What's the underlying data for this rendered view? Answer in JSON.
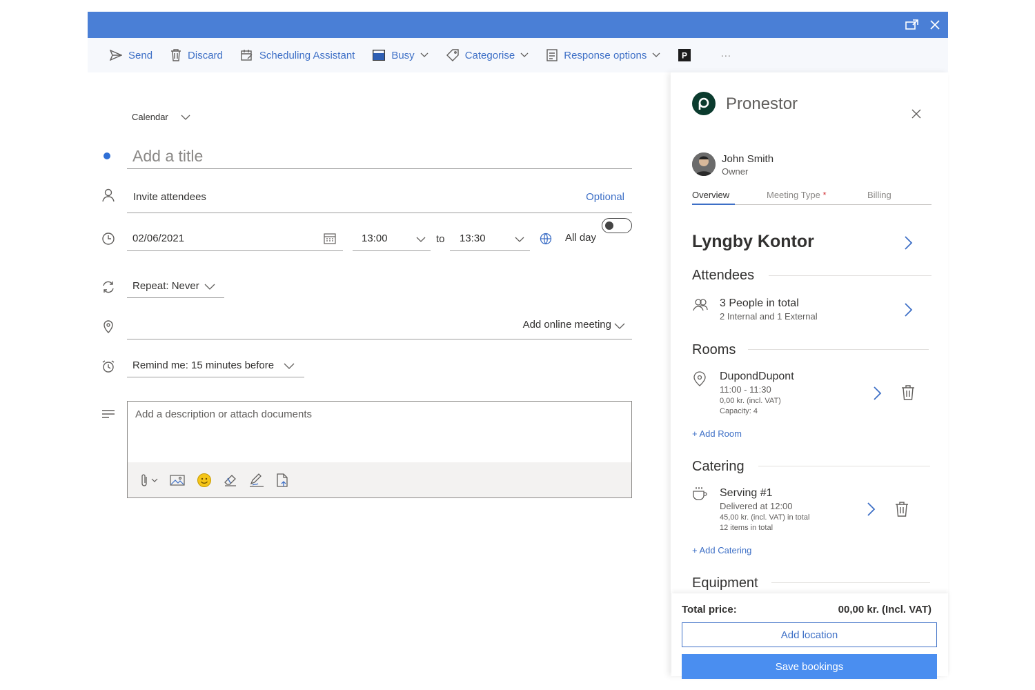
{
  "toolbar": {
    "send": "Send",
    "discard": "Discard",
    "scheduling": "Scheduling Assistant",
    "busy": "Busy",
    "categorise": "Categorise",
    "response": "Response options",
    "more": "···"
  },
  "form": {
    "calendar": "Calendar",
    "title_placeholder": "Add a title",
    "attendees_placeholder": "Invite attendees",
    "optional": "Optional",
    "date": "02/06/2021",
    "start_time": "13:00",
    "to": "to",
    "end_time": "13:30",
    "all_day": "All day",
    "repeat": "Repeat: Never",
    "online_meeting": "Add online meeting",
    "remind": "Remind me: 15 minutes before",
    "description_placeholder": "Add a description or attach documents"
  },
  "panel": {
    "brand": "Pronestor",
    "user": {
      "name": "John Smith",
      "role": "Owner"
    },
    "tabs": [
      {
        "label": "Overview",
        "active": true
      },
      {
        "label": "Meeting Type",
        "required_mark": "*"
      },
      {
        "label": "Billing"
      }
    ],
    "location": "Lyngby Kontor",
    "attendees": {
      "heading": "Attendees",
      "total": "3 People in total",
      "breakdown": "2 Internal and 1 External"
    },
    "rooms": {
      "heading": "Rooms",
      "name": "DupondDupont",
      "time": "11:00 - 11:30",
      "price": "0,00 kr. (incl. VAT)",
      "capacity": "Capacity: 4",
      "add": "+ Add Room"
    },
    "catering": {
      "heading": "Catering",
      "name": "Serving #1",
      "delivered": "Delivered at 12:00",
      "price": "45,00 kr. (incl. VAT) in total",
      "items": "12 items in total",
      "add": "+ Add Catering"
    },
    "equipment": {
      "heading": "Equipment"
    },
    "footer": {
      "total_label": "Total price:",
      "total_value": "00,00 kr. (Incl. VAT)",
      "add_location": "Add location",
      "save": "Save bookings"
    }
  },
  "colors": {
    "titlebar": "#4a7fd6",
    "accent": "#3d6fc6",
    "primary_button": "#4a8ef0",
    "brand": "#0b3b2e"
  }
}
